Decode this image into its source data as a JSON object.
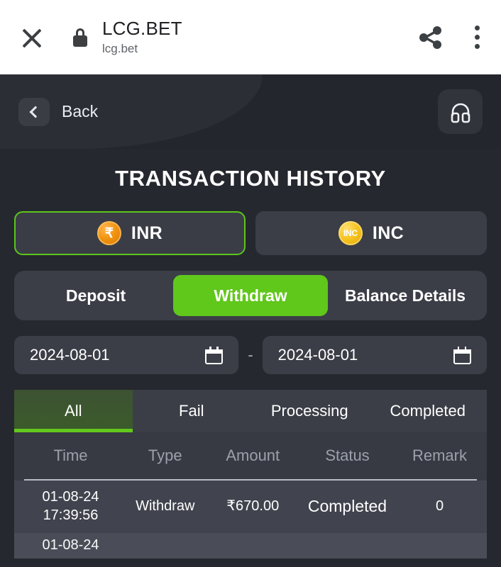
{
  "browser_bar": {
    "close_icon": "close-icon",
    "lock_icon": "lock-icon",
    "title": "LCG.BET",
    "url": "lcg.bet",
    "share_icon": "share-icon",
    "more_icon": "more-vertical-icon"
  },
  "app_header": {
    "back_label": "Back",
    "back_icon": "chevron-left-icon",
    "support_icon": "headphones-icon"
  },
  "page": {
    "title": "TRANSACTION HISTORY"
  },
  "currency_tabs": [
    {
      "label": "INR",
      "coin_text": "₹",
      "coin_kind": "inr",
      "active": true
    },
    {
      "label": "INC",
      "coin_text": "INC",
      "coin_kind": "inc",
      "active": false
    }
  ],
  "segments": [
    {
      "label": "Deposit",
      "active": false
    },
    {
      "label": "Withdraw",
      "active": true
    },
    {
      "label": "Balance Details",
      "active": false
    }
  ],
  "date_range": {
    "start": "2024-08-01",
    "end": "2024-08-01",
    "separator": "-",
    "calendar_icon": "calendar-icon"
  },
  "filter_tabs": [
    {
      "label": "All",
      "active": true
    },
    {
      "label": "Fail",
      "active": false
    },
    {
      "label": "Processing",
      "active": false
    },
    {
      "label": "Completed",
      "active": false
    }
  ],
  "table": {
    "columns": [
      "Time",
      "Type",
      "Amount",
      "Status",
      "Remark"
    ],
    "rows": [
      {
        "time": "01-08-24\n17:39:56",
        "time_date": "01-08-24",
        "time_clock": "17:39:56",
        "type": "Withdraw",
        "amount": "₹670.00",
        "status": "Completed",
        "remark": "0"
      },
      {
        "time_date": "01-08-24",
        "time_clock": "",
        "type": "",
        "amount": "",
        "status": "",
        "remark": ""
      }
    ]
  },
  "colors": {
    "accent_green": "#60c71b",
    "page_bg": "#26282f",
    "panel": "#3b3e47",
    "coin_inr": "#f0920d",
    "coin_inc": "#f5c21e"
  }
}
